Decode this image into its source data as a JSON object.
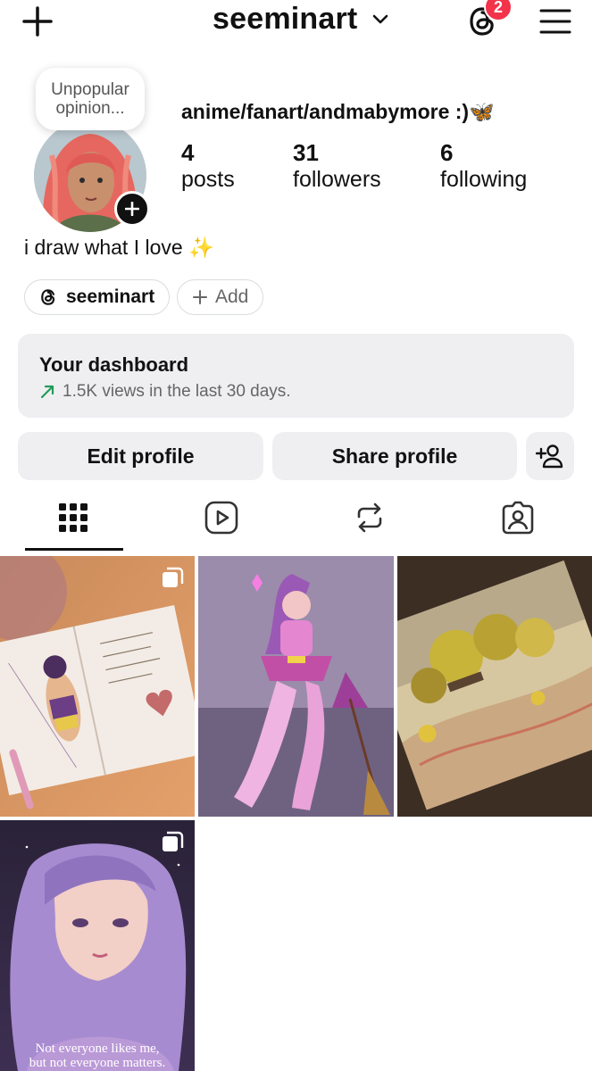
{
  "header": {
    "username": "seeminart",
    "threads_badge_count": "2"
  },
  "profile": {
    "note": "Unpopular opinion...",
    "display_name": "anime/fanart/andmabymore :)🦋",
    "stats": [
      {
        "value": "4",
        "label": "posts"
      },
      {
        "value": "31",
        "label": "followers"
      },
      {
        "value": "6",
        "label": "following"
      }
    ],
    "bio": "i draw what I love ✨",
    "threads_chip": "seeminart",
    "add_chip": "Add"
  },
  "dashboard": {
    "title": "Your dashboard",
    "subtitle": "1.5K views in the last 30 days."
  },
  "actions": {
    "edit_profile": "Edit profile",
    "share_profile": "Share profile"
  },
  "tabs": [
    "grid-icon",
    "reels-icon",
    "reposts-icon",
    "tagged-icon"
  ],
  "posts": [
    {
      "kind": "carousel",
      "theme": "sketchbook-warm"
    },
    {
      "kind": "single",
      "theme": "purple-magical-girl"
    },
    {
      "kind": "single",
      "theme": "autumn-landscape"
    },
    {
      "kind": "carousel",
      "theme": "purple-portrait",
      "caption_line1": "Not everyone likes me,",
      "caption_line2": "but not everyone matters."
    }
  ],
  "colors": {
    "badge": "#f2334a",
    "dashboard_bg": "#efeff2",
    "trend_green": "#1f9d57"
  }
}
